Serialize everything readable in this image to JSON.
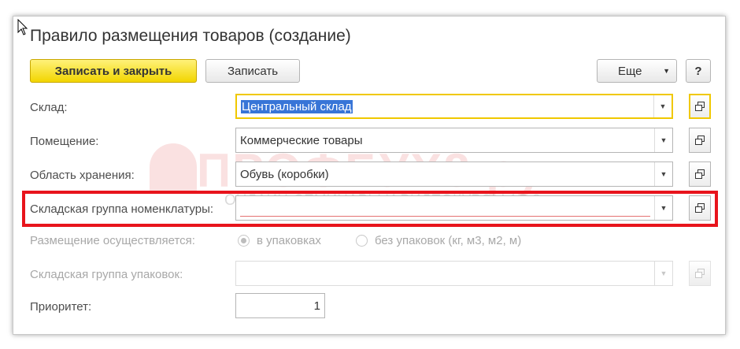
{
  "window": {
    "title": "Правило размещения товаров (создание)"
  },
  "toolbar": {
    "save_close_label": "Записать и закрыть",
    "save_label": "Записать",
    "more_label": "Еще",
    "help_label": "?"
  },
  "form": {
    "warehouse": {
      "label": "Склад:",
      "value": "Центральный склад"
    },
    "room": {
      "label": "Помещение:",
      "value": "Коммерческие товары"
    },
    "storage_area": {
      "label": "Область хранения:",
      "value": "Обувь (коробки)"
    },
    "item_group": {
      "label": "Складская группа номенклатуры:",
      "value": ""
    },
    "placement": {
      "label": "Размещение осуществляется:",
      "options": [
        "в упаковках",
        "без упаковок (кг, м3, м2, м)"
      ],
      "selected": "в упаковках"
    },
    "package_group": {
      "label": "Складская группа упаковок:",
      "value": ""
    },
    "priority": {
      "label": "Приоритет:",
      "value": "1"
    }
  },
  "watermark": {
    "main": "ПРОФБУХ8.ру",
    "sub": "ОНЛАЙН-СЕМИНАРЫ И ВИДЕОКУРСЫ 1С:8"
  },
  "colors": {
    "primary_button": "#f2d500",
    "highlight": "#e8141c",
    "focus_border": "#f0c800",
    "selection": "#3875d7"
  }
}
